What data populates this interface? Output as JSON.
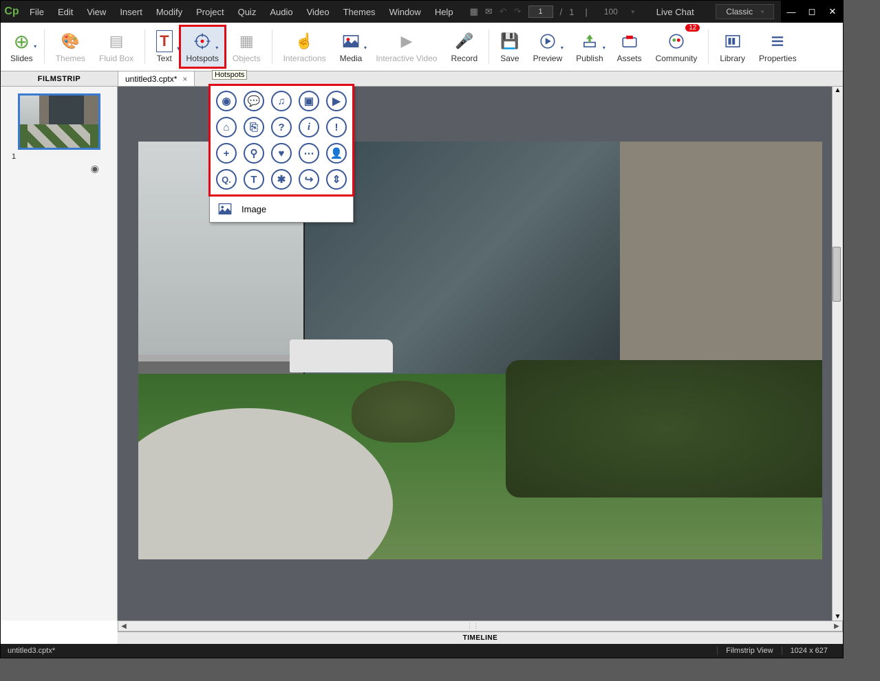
{
  "menu": [
    "File",
    "Edit",
    "View",
    "Insert",
    "Modify",
    "Project",
    "Quiz",
    "Audio",
    "Video",
    "Themes",
    "Window",
    "Help"
  ],
  "page": {
    "current": "1",
    "sep": "/",
    "total": "1",
    "divider": "|",
    "zoom": "100"
  },
  "live_chat": "Live Chat",
  "workspace_selector": "Classic",
  "toolbar": [
    "Slides",
    "Themes",
    "Fluid Box",
    "Text",
    "Hotspots",
    "Objects",
    "Interactions",
    "Media",
    "Interactive Video",
    "Record",
    "Save",
    "Preview",
    "Publish",
    "Assets",
    "Community",
    "Library",
    "Properties"
  ],
  "community_badge": "12",
  "tooltip": "Hotspots",
  "tabs": {
    "filmstrip": "FILMSTRIP",
    "file": "untitled3.cptx*"
  },
  "slide_number": "1",
  "hotspot_image": "Image",
  "timeline": "TIMELINE",
  "status": {
    "file": "untitled3.cptx*",
    "view": "Filmstrip View",
    "dims": "1024 x 627"
  }
}
